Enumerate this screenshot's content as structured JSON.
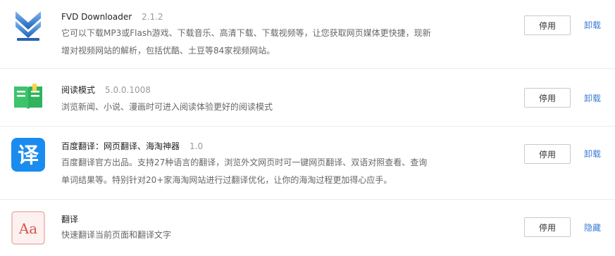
{
  "extensions": [
    {
      "name": "FVD Downloader",
      "version": "2.1.2",
      "description": "它可以下载MP3或Flash游戏、下载音乐、高清下载、下载视频等，让您获取网页媒体更快捷，现新增对视频网站的解析，包括优酷、土豆等84家视频网站。",
      "disable_label": "停用",
      "action_label": "卸载",
      "icon": "download-arrow-icon"
    },
    {
      "name": "阅读模式",
      "version": "5.0.0.1008",
      "description": "浏览新闻、小说、漫画时可进入阅读体验更好的阅读模式",
      "disable_label": "停用",
      "action_label": "卸载",
      "icon": "book-icon"
    },
    {
      "name": "百度翻译：网页翻译、海淘神器",
      "version": "1.0",
      "description": "百度翻译官方出品。支持27种语言的翻译，浏览外文网页时可一键网页翻译、双语对照查看、查询单词结果等。特别针对20+家海淘网站进行过翻译优化，让你的海淘过程更加得心应手。",
      "disable_label": "停用",
      "action_label": "卸载",
      "icon": "translate-yi-icon",
      "icon_text": "译"
    },
    {
      "name": "翻译",
      "version": "",
      "description": "快速翻译当前页面和翻译文字",
      "disable_label": "停用",
      "action_label": "隐藏",
      "icon": "font-aa-icon",
      "icon_text": "Aa"
    }
  ],
  "colors": {
    "link": "#3a7bd5",
    "translate_blue": "#1a8cf0",
    "reading_green": "#3cc36b",
    "aa_red": "#d9534f"
  }
}
